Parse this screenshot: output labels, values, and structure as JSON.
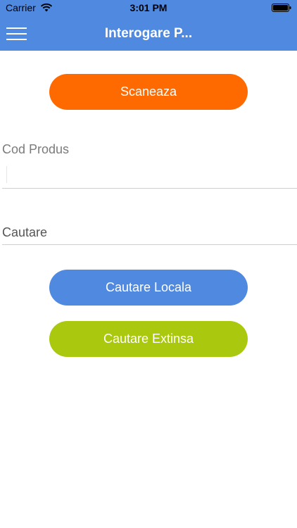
{
  "status_bar": {
    "carrier": "Carrier",
    "time": "3:01 PM",
    "icons": [
      "wifi-icon",
      "battery-icon"
    ]
  },
  "navbar": {
    "title": "Interogare P...",
    "menu_icon": "hamburger-menu-icon",
    "background": "#5089e0"
  },
  "actions": {
    "scan_label": "Scaneaza",
    "scan_color": "#ff6a00",
    "local_search_label": "Cautare Locala",
    "local_search_color": "#5089e0",
    "extended_search_label": "Cautare Extinsa",
    "extended_search_color": "#aac80e"
  },
  "fields": {
    "product_code_label": "Cod Produs",
    "product_code_value": "",
    "search_placeholder": "Cautare",
    "search_value": ""
  }
}
